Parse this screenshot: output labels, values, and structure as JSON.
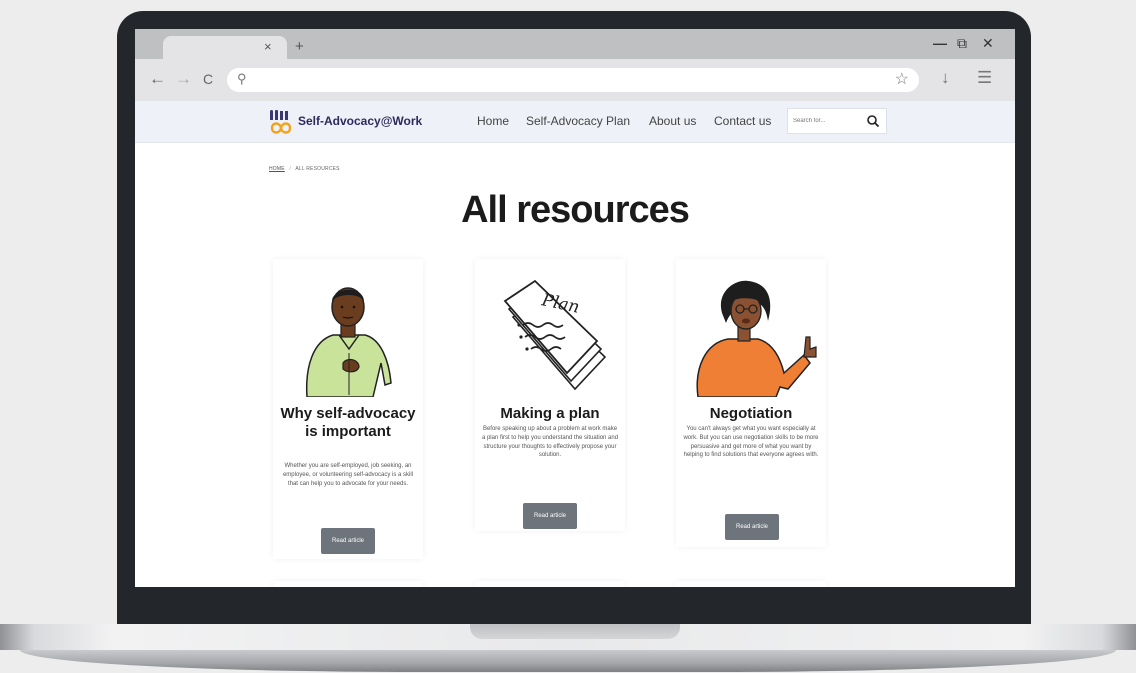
{
  "browser": {
    "tab_close": "×",
    "new_tab": "+",
    "minimize": "—",
    "restore": "⧉",
    "close": "✕",
    "back": "←",
    "forward": "→",
    "reload": "C",
    "search_glyph": "⚲",
    "star_glyph": "☆",
    "download_glyph": "↓",
    "menu_glyph": "☰"
  },
  "site": {
    "logo_text": "Self-Advocacy@Work",
    "nav": [
      "Home",
      "Self-Advocacy Plan",
      "About us",
      "Contact us"
    ],
    "search_placeholder": "Search for..."
  },
  "breadcrumb": {
    "home": "HOME",
    "separator": "/",
    "current": "ALL RESOURCES"
  },
  "page_title": "All resources",
  "cards": [
    {
      "title": "Why self-advocacy is important",
      "description": "Whether you are self-employed, job seeking, an employee, or volunteering self-advocacy is a skill that can help you to advocate for your needs.",
      "button": "Read article"
    },
    {
      "title": "Making a plan",
      "description": "Before speaking up about a problem at work make a plan first to help you understand the situation and structure your thoughts to effectively propose your solution.",
      "button": "Read article",
      "art_text": "Plan"
    },
    {
      "title": "Negotiation",
      "description": "You can't always get what you want especially at work. But you can use negotiation skills to be more persuasive and get more of what you want by helping to find solutions that everyone agrees with.",
      "button": "Read article"
    }
  ],
  "colors": {
    "header_bg": "#eef1f7",
    "button_bg": "#6d747c",
    "logo_text": "#2f2a5c",
    "orange_shirt": "#ef7f35",
    "green_shirt": "#c9e49a"
  }
}
